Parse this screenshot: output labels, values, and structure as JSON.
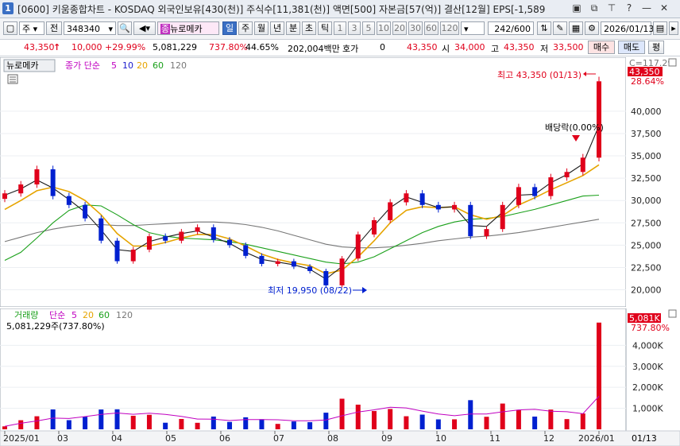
{
  "window": {
    "badge": "1",
    "title": "[0600] 키움종합차트 - KOSDAQ 외국인보유[430(천)] 주식수[11,381(천)] 액면[500] 자본금[57(억)] 결산[12월] EPS[-1,589"
  },
  "toolbar": {
    "market": "주",
    "prev_label": "전",
    "code": "348340",
    "stock_name": "뉴로메카",
    "stock_badge": "종",
    "periods": [
      "일",
      "주",
      "월",
      "년",
      "분",
      "초",
      "틱"
    ],
    "intervals": [
      "1",
      "3",
      "5",
      "10",
      "20",
      "30",
      "60",
      "120"
    ],
    "count": "242",
    "count_total": "/600",
    "date": "2026/01/13"
  },
  "quote": {
    "price": "43,350",
    "arrow": "↑",
    "change": "10,000",
    "change_pct": "+29.99%",
    "volume": "5,081,229",
    "vol_ratio": "737.80%",
    "turnover": "44.65%",
    "amount": "202,004백만",
    "hoga_label": "호가",
    "hoga_value": "0",
    "hoga_price": "43,350",
    "open_label": "시",
    "open": "34,000",
    "high_label": "고",
    "high": "43,350",
    "low_label": "저",
    "low": "33,500",
    "buy_label": "매수",
    "sell_label": "매도",
    "extra_label": "평"
  },
  "legend": {
    "stock_name": "뉴로메카",
    "ma_title": "종가 단순",
    "ma": [
      "5",
      "10",
      "20",
      "60",
      "120"
    ],
    "vol_title": "거래량",
    "vol_ma_title": "단순",
    "vol_ma": [
      "5",
      "20",
      "60",
      "120"
    ],
    "vol_value": "5,081,229주(737.80%)"
  },
  "annotations": {
    "high_note": "최고 43,350 (01/13)",
    "low_note": "최저 19,950 (08/22)",
    "dividend_note": "배당락(0.00%)",
    "price_tag": "43,350",
    "price_pct": "28.64%",
    "top_tag": "C=117.29",
    "vol_tag": "5,081K",
    "vol_pct": "737.80%"
  },
  "colors": {
    "up": "#e0001b",
    "down": "#0020d0",
    "ma5": "#1a1a1a",
    "ma20": "#e6a400",
    "ma60": "#1aa01a",
    "ma120": "#777777",
    "vol_ma5": "#c000c0"
  },
  "chart_data": {
    "type": "candlestick",
    "x_ticks": [
      "2025/01",
      "03",
      "04",
      "05",
      "06",
      "07",
      "08",
      "09",
      "10",
      "11",
      "12",
      "2026/01"
    ],
    "x_end_label": "01/13",
    "price_axis": [
      "40,000",
      "37,500",
      "35,000",
      "32,500",
      "30,000",
      "27,500",
      "25,000",
      "22,500",
      "20,000"
    ],
    "volume_axis": [
      "4,000K",
      "3,000K",
      "2,000K",
      "1,000K"
    ],
    "ylim_price": [
      18800,
      44800
    ],
    "ylim_volume": [
      0,
      5300000
    ],
    "series": [
      {
        "name": "종가",
        "values": [
          30800,
          31800,
          33500,
          30500,
          29500,
          28000,
          25500,
          23200,
          24500,
          26000,
          25500,
          26500,
          27000,
          25600,
          25000,
          23800,
          22900,
          23200,
          22600,
          22100,
          20500,
          23500,
          26200,
          27800,
          29800,
          30800,
          29500,
          29000,
          29500,
          26000,
          26800,
          29500,
          31500,
          30500,
          32600,
          33200,
          34800,
          43350
        ]
      },
      {
        "name": "5",
        "values": [
          30600,
          31300,
          32300,
          31400,
          30100,
          28700,
          26700,
          24500,
          24300,
          25400,
          25900,
          26300,
          26600,
          25900,
          25200,
          24200,
          23400,
          23100,
          22800,
          22300,
          21200,
          22600,
          25100,
          27200,
          29200,
          30400,
          29800,
          29200,
          29300,
          27200,
          27100,
          28700,
          30600,
          30700,
          32000,
          32900,
          34100,
          38400
        ]
      },
      {
        "name": "20",
        "values": [
          29000,
          30000,
          31100,
          31500,
          31000,
          30000,
          28400,
          26300,
          24900,
          24900,
          25300,
          25800,
          26200,
          26200,
          25700,
          24900,
          24000,
          23400,
          23000,
          22700,
          21800,
          22200,
          23700,
          25500,
          27500,
          28900,
          29300,
          29200,
          29300,
          28400,
          27900,
          28300,
          29500,
          30300,
          31200,
          32000,
          32800,
          34000
        ]
      },
      {
        "name": "60",
        "values": [
          23300,
          24200,
          25800,
          27500,
          28900,
          29500,
          29400,
          28400,
          27300,
          26400,
          26000,
          25800,
          25700,
          25600,
          25400,
          25100,
          24700,
          24300,
          23900,
          23500,
          23100,
          22900,
          23100,
          23700,
          24600,
          25500,
          26400,
          27100,
          27600,
          27900,
          28000,
          28200,
          28600,
          29000,
          29500,
          30000,
          30500,
          30600
        ]
      },
      {
        "name": "120",
        "values": [
          25400,
          25900,
          26400,
          26800,
          27100,
          27300,
          27300,
          27200,
          27200,
          27300,
          27400,
          27500,
          27600,
          27600,
          27500,
          27300,
          27000,
          26600,
          26100,
          25600,
          25100,
          24800,
          24700,
          24700,
          24800,
          25000,
          25200,
          25500,
          25700,
          25900,
          26000,
          26200,
          26400,
          26700,
          27000,
          27300,
          27600,
          27900
        ]
      }
    ]
  }
}
